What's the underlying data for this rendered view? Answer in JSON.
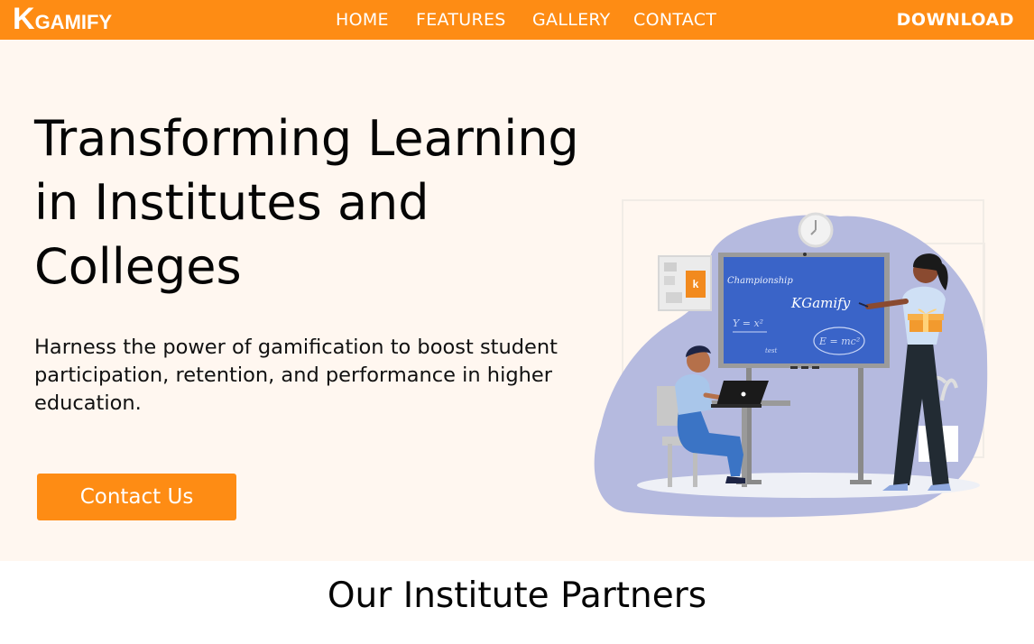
{
  "nav": {
    "logo_k": "K",
    "logo_rest": "GAMIFY",
    "items": [
      {
        "label": "HOME"
      },
      {
        "label": "FEATURES"
      },
      {
        "label": "GALLERY"
      },
      {
        "label": "CONTACT"
      }
    ],
    "download_label": "DOWNLOAD"
  },
  "hero": {
    "title": "Transforming Learning in Institutes and Colleges",
    "subtitle": "Harness the power of gamification to boost student participation, retention, and performance in higher education.",
    "cta_label": "Contact Us",
    "illustration": {
      "board_title": "Championship",
      "board_brand": "KGamify",
      "board_equation_left": "Y = x²",
      "board_equation_right": "E = mc²",
      "board_note": "test",
      "poster_letter": "k"
    }
  },
  "partners": {
    "title": "Our Institute Partners"
  },
  "colors": {
    "brand_orange": "#fe8c14",
    "hero_background": "#fff7f0",
    "board_blue": "#3a64c8",
    "blob_lavender": "#b5badf"
  }
}
